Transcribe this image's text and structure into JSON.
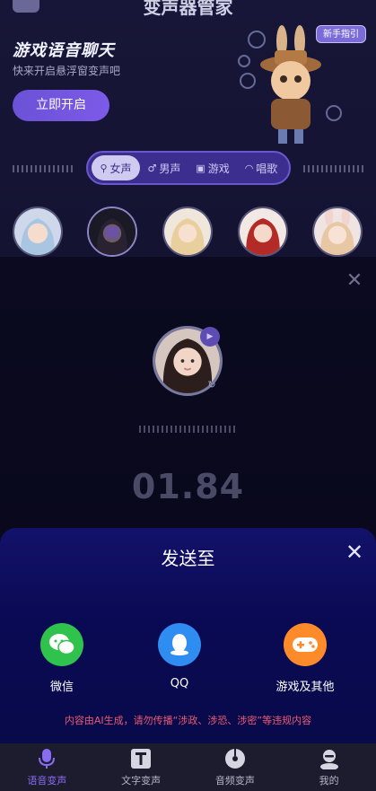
{
  "app": {
    "title": "变声器管家"
  },
  "hero": {
    "title": "游戏语音聊天",
    "subtitle": "快来开启悬浮窗变声吧",
    "button": "立即开启",
    "badge": "新手指引"
  },
  "tabs": [
    {
      "label": "女声",
      "icon": "search-icon",
      "active": true
    },
    {
      "label": "男声",
      "icon": "male-icon",
      "active": false
    },
    {
      "label": "游戏",
      "icon": "gamepad-icon",
      "active": false
    },
    {
      "label": "唱歌",
      "icon": "headphones-icon",
      "active": false
    }
  ],
  "voice": {
    "duration": "01.84"
  },
  "share": {
    "title": "发送至",
    "items": [
      {
        "label": "微信",
        "color": "#2fc24d",
        "icon": "wechat-icon"
      },
      {
        "label": "QQ",
        "color": "#2f8cf0",
        "icon": "qq-icon"
      },
      {
        "label": "游戏及其他",
        "color": "#ff8a2a",
        "icon": "gamepad-icon"
      }
    ],
    "disclaimer": "内容由AI生成，请勿传播“涉政、涉恐、涉密”等违规内容"
  },
  "nav": [
    {
      "label": "语音变声",
      "icon": "microphone-icon",
      "active": true
    },
    {
      "label": "文字变声",
      "icon": "text-icon",
      "active": false
    },
    {
      "label": "音频变声",
      "icon": "disc-icon",
      "active": false
    },
    {
      "label": "我的",
      "icon": "user-icon",
      "active": false
    }
  ],
  "colors": {
    "accent": "#7d5ae8",
    "sheet": "#0a0a55",
    "warning": "#ec5a6f"
  }
}
